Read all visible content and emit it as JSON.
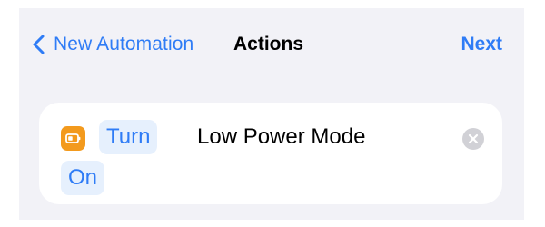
{
  "nav": {
    "back_label": "New Automation",
    "title": "Actions",
    "next_label": "Next"
  },
  "action": {
    "verb_parameter": "Turn",
    "name": "Low Power Mode",
    "state_parameter": "On",
    "icon": "battery-icon",
    "clear_icon": "clear-icon"
  },
  "colors": {
    "accent": "#2f7cf6",
    "icon_background": "#f39a1d",
    "parameter_background": "#e6f0fd",
    "screen_background": "#f2f2f7",
    "card_background": "#ffffff"
  }
}
